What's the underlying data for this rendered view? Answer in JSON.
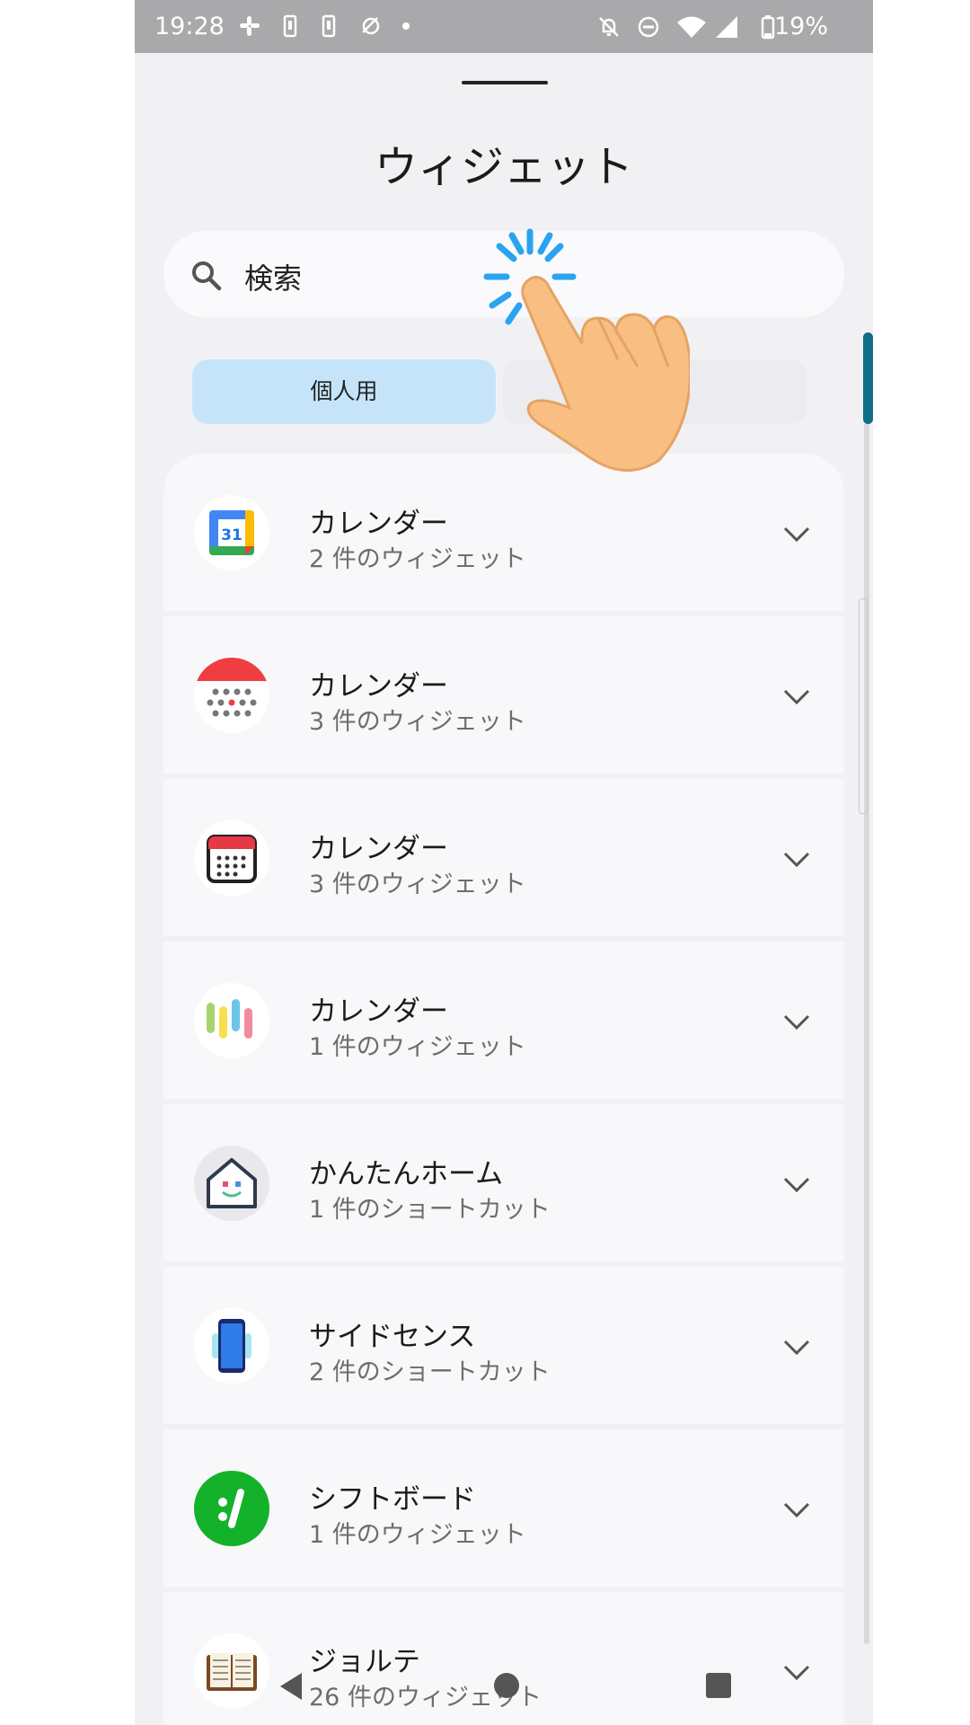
{
  "status_bar": {
    "time": "19:28",
    "battery": "19%"
  },
  "title": "ウィジェット",
  "search": {
    "placeholder": "検索"
  },
  "tabs": [
    {
      "label": "個人用",
      "selected": true
    },
    {
      "label": "",
      "selected": false
    }
  ],
  "items": [
    {
      "name": "カレンダー",
      "sub": "2 件のウィジェット"
    },
    {
      "name": "カレンダー",
      "sub": "3 件のウィジェット"
    },
    {
      "name": "カレンダー",
      "sub": "3 件のウィジェット"
    },
    {
      "name": "カレンダー",
      "sub": "1 件のウィジェット"
    },
    {
      "name": "かんたんホーム",
      "sub": "1 件のショートカット"
    },
    {
      "name": "サイドセンス",
      "sub": "2 件のショートカット"
    },
    {
      "name": "シフトボード",
      "sub": "1 件のウィジェット"
    },
    {
      "name": "ジョルテ",
      "sub": "26 件のウィジェット"
    }
  ],
  "google_calendar_icon_text": "31",
  "colors": {
    "accent": "#0f6e8a",
    "tab_selected": "#c5e4fa",
    "touch": "#2aa3f0"
  }
}
